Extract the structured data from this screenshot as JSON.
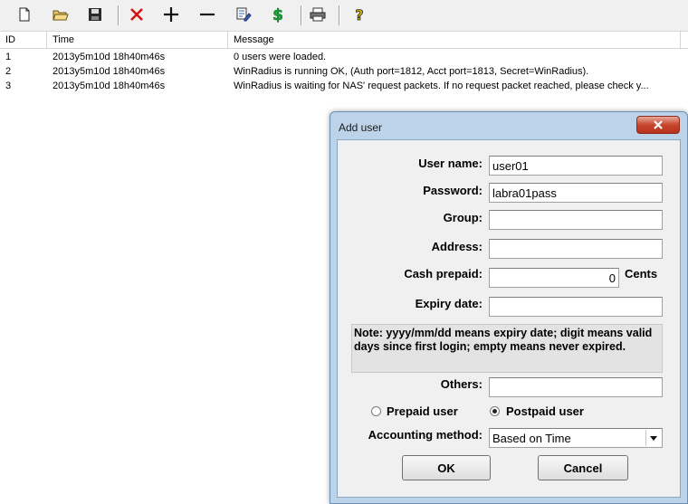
{
  "toolbar": {
    "buttons": [
      {
        "icon": "new-file-icon"
      },
      {
        "icon": "open-folder-icon"
      },
      {
        "icon": "save-disk-icon"
      },
      {
        "icon": "delete-x-icon",
        "color": "#d21414"
      },
      {
        "icon": "plus-icon"
      },
      {
        "icon": "minus-icon"
      },
      {
        "icon": "edit-icon"
      },
      {
        "icon": "dollar-icon",
        "color": "#1aa33a"
      },
      {
        "icon": "printer-icon"
      },
      {
        "icon": "help-question-icon",
        "color": "#d7b800"
      }
    ]
  },
  "log": {
    "columns": [
      "ID",
      "Time",
      "Message"
    ],
    "rows": [
      {
        "id": "1",
        "time": "2013y5m10d 18h40m46s",
        "message": "0 users were loaded."
      },
      {
        "id": "2",
        "time": "2013y5m10d 18h40m46s",
        "message": "WinRadius is running OK, (Auth port=1812, Acct port=1813, Secret=WinRadius)."
      },
      {
        "id": "3",
        "time": "2013y5m10d 18h40m46s",
        "message": "WinRadius is waiting for NAS' request packets. If no request packet reached, please check y..."
      }
    ]
  },
  "dialog": {
    "title": "Add user",
    "labels": {
      "username": "User name:",
      "password": "Password:",
      "group": "Group:",
      "address": "Address:",
      "cash": "Cash prepaid:",
      "cents": "Cents",
      "expiry": "Expiry date:",
      "others": "Others:",
      "accounting": "Accounting method:"
    },
    "values": {
      "username": "user01",
      "password": "labra01pass",
      "group": "",
      "address": "",
      "cash": "0",
      "expiry": "",
      "others": ""
    },
    "note": "Note: yyyy/mm/dd means expiry date; digit means valid days since first login; empty means never expired.",
    "radio_prepaid": "Prepaid user",
    "radio_postpaid": "Postpaid user",
    "accounting_selected": "Based on Time",
    "ok_label": "OK",
    "cancel_label": "Cancel"
  }
}
